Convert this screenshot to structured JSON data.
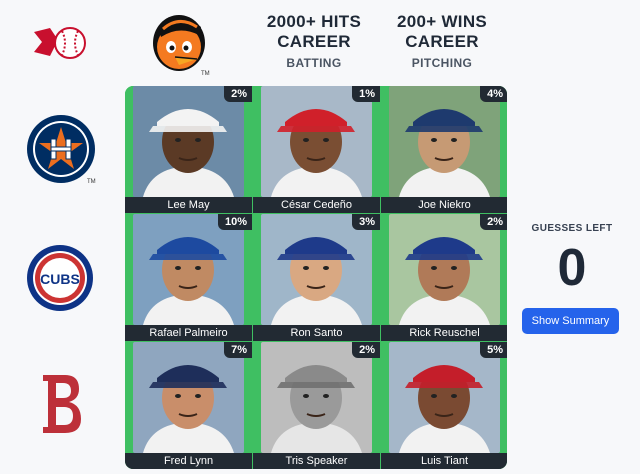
{
  "header": {
    "col1": {
      "line1": "2000+ HITS",
      "line2": "CAREER",
      "sub": "BATTING"
    },
    "col2": {
      "line1": "200+ WINS",
      "line2": "CAREER",
      "sub": "PITCHING"
    }
  },
  "teams": {
    "corner": "reds-icon",
    "col_team": "orioles-logo",
    "rows": [
      "astros-logo",
      "cubs-logo",
      "red-sox-logo"
    ],
    "row_labels": [
      "TM",
      "",
      ""
    ],
    "cubs_text": "CUBS",
    "astros_tm": "TM",
    "orioles_tm": "TM"
  },
  "grid": {
    "rows": [
      [
        {
          "name": "Lee May",
          "pct": "2%"
        },
        {
          "name": "César Cedeño",
          "pct": "1%"
        },
        {
          "name": "Joe Niekro",
          "pct": "4%"
        }
      ],
      [
        {
          "name": "Rafael Palmeiro",
          "pct": "10%"
        },
        {
          "name": "Ron Santo",
          "pct": "3%"
        },
        {
          "name": "Rick Reuschel",
          "pct": "2%"
        }
      ],
      [
        {
          "name": "Fred Lynn",
          "pct": "7%"
        },
        {
          "name": "Tris Speaker",
          "pct": "2%"
        },
        {
          "name": "Luis Tiant",
          "pct": "5%"
        }
      ]
    ]
  },
  "sidebar": {
    "guesses_label": "GUESSES LEFT",
    "guesses_count": "0",
    "button_label": "Show Summary"
  },
  "colors": {
    "correct_green": "#3fbf62",
    "label_bg": "#222a33",
    "button_blue": "#2563eb"
  }
}
